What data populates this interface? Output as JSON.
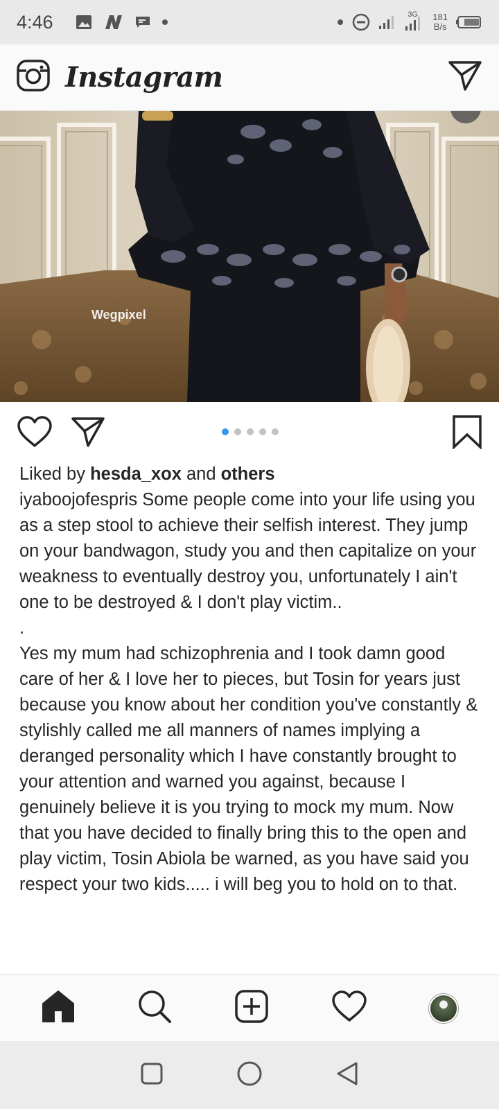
{
  "status_bar": {
    "time": "4:46",
    "network": "3G",
    "speed_value": "181",
    "speed_unit": "B/s"
  },
  "app": {
    "name": "Instagram"
  },
  "post": {
    "watermark": "Wegpixel",
    "carousel": {
      "count": 5,
      "active_index": 0
    },
    "liked_prefix": "Liked by ",
    "liked_user": "hesda_xox",
    "liked_and": " and ",
    "liked_others": "others",
    "caption_user": "iyaboojofespris",
    "caption_text": "Some people come into your life using you as a step stool  to achieve their selfish interest.  They jump on your bandwagon, study you and then capitalize on your weakness to eventually destroy you, unfortunately I ain't one to be destroyed & I don't play victim..\n.\nYes my mum had schizophrenia and I took damn good care of her & I love her to pieces, but Tosin for years just because you know about her condition you've constantly & stylishly called me all manners of names implying a deranged personality which I have constantly  brought to your attention and warned you against, because I genuinely believe it is you trying to mock my mum. Now that you have decided to finally bring this to the open and play victim, Tosin Abiola be warned, as you have said you respect your two kids..... i will beg you to hold on to that."
  },
  "colors": {
    "accent": "#3897f0",
    "text": "#262626"
  },
  "icons": {
    "camera": "camera-icon",
    "direct": "paper-plane-icon",
    "heart": "heart-icon",
    "share": "paper-plane-icon",
    "bookmark": "bookmark-icon",
    "home": "home-icon",
    "search": "search-icon",
    "add": "add-post-icon",
    "activity": "heart-icon",
    "profile": "avatar"
  }
}
